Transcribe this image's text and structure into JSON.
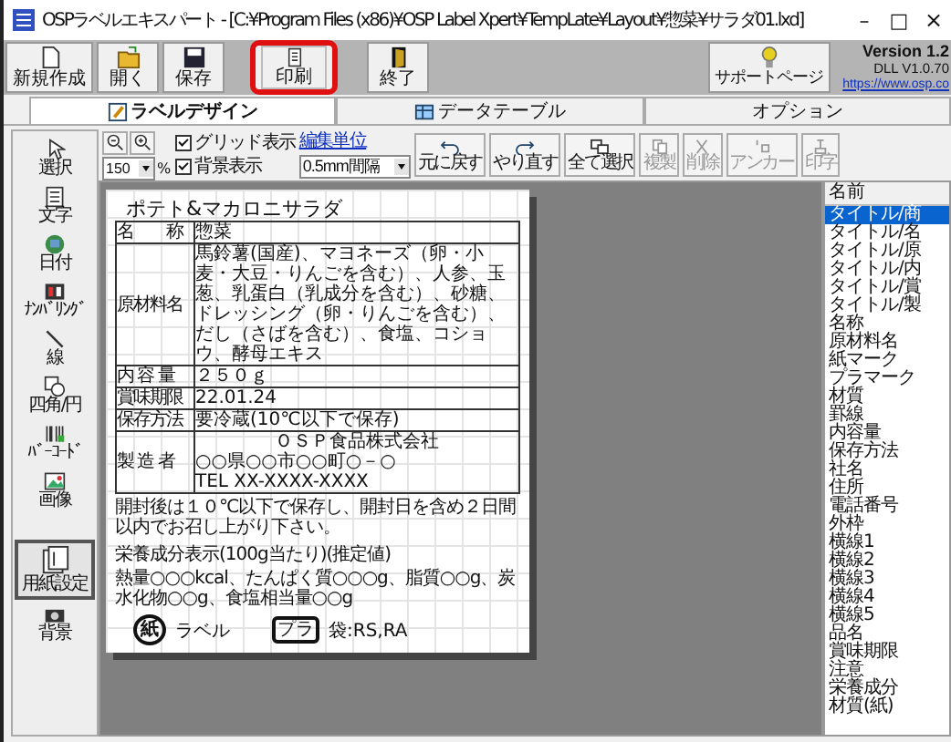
{
  "window": {
    "title": "OSPラベルエキスパート - [C:¥Program Files (x86)¥OSP Label Xpert¥TempLate¥Layout¥惣菜¥サラダ01.lxd]",
    "controls": [
      {
        "kind": "minimize",
        "label": "–"
      },
      {
        "kind": "maximize",
        "label": "□"
      },
      {
        "kind": "close",
        "label": "×"
      }
    ]
  },
  "toolbar": {
    "buttons": [
      {
        "kind": "new",
        "label": "新規作成",
        "highlighted": false
      },
      {
        "kind": "open",
        "label": "開く",
        "highlighted": false
      },
      {
        "kind": "save",
        "label": "保存",
        "highlighted": false
      },
      {
        "kind": "print",
        "label": "印刷",
        "highlighted": true
      },
      {
        "kind": "exit",
        "label": "終了",
        "highlighted": false
      }
    ],
    "support_button": "サポートページ",
    "version": "Version 1.2",
    "dll": "DLL V1.0.70",
    "url": "https://www.osp.co"
  },
  "tabs": [
    {
      "kind": "design",
      "label": "ラベルデザイン",
      "selected": true
    },
    {
      "kind": "table",
      "label": "データテーブル",
      "selected": false
    },
    {
      "kind": "option",
      "label": "オプション",
      "selected": false
    }
  ],
  "tools": [
    {
      "kind": "select",
      "label": "選択",
      "selected": false
    },
    {
      "kind": "text",
      "label": "文字",
      "selected": false
    },
    {
      "kind": "date",
      "label": "日付",
      "selected": false
    },
    {
      "kind": "numbering",
      "label": "ﾅﾝﾊﾞﾘﾝｸﾞ",
      "selected": false
    },
    {
      "kind": "line",
      "label": "線",
      "selected": false
    },
    {
      "kind": "rect",
      "label": "四角/円",
      "selected": false
    },
    {
      "kind": "barcode",
      "label": "ﾊﾞｰｺｰﾄﾞ",
      "selected": false
    },
    {
      "kind": "image",
      "label": "画像",
      "selected": false
    },
    {
      "kind": "paper",
      "label": "用紙設定",
      "selected": true
    },
    {
      "kind": "background",
      "label": "背景",
      "selected": false
    }
  ],
  "design_toolbar": {
    "zoom": "150",
    "zoom_unit": "%",
    "grid": {
      "label": "グリッド表示",
      "checked": true
    },
    "background": {
      "label": "背景表示",
      "checked": true
    },
    "unit_link": "編集単位",
    "unit": "0.5mm間隔",
    "buttons": [
      {
        "kind": "undo",
        "label": "元に戻す",
        "disabled": false
      },
      {
        "kind": "redo",
        "label": "やり直す",
        "disabled": false
      },
      {
        "kind": "select_all",
        "label": "全て選択",
        "disabled": false
      },
      {
        "kind": "copy",
        "label": "複製",
        "disabled": true
      },
      {
        "kind": "delete",
        "label": "削除",
        "disabled": true
      },
      {
        "kind": "anchor",
        "label": "アンカー",
        "disabled": true
      },
      {
        "kind": "print",
        "label": "印字",
        "disabled": true
      }
    ]
  },
  "label": {
    "title": "ポテト&マカロニサラダ",
    "rows": [
      {
        "heading": "名　　称",
        "lines": [
          "惣菜"
        ]
      },
      {
        "heading": "原材料名",
        "lines": [
          "馬鈴薯(国産)、マヨネーズ（卵・小麦・大豆・りんごを含む）、人参、玉葱、乳蛋白（乳成分を含む）、砂糖、ドレッシング（卵・りんごを含む）、だし（さばを含む）、食塩、コショウ、酵母エキス"
        ]
      },
      {
        "heading": "内 容 量",
        "lines": [
          "２５０ｇ"
        ]
      },
      {
        "heading": "賞味期限",
        "lines": [
          "22.01.24"
        ]
      },
      {
        "heading": "保存方法",
        "lines": [
          "要冷蔵(10℃以下で保存)"
        ]
      },
      {
        "heading": "製 造 者",
        "lines": [
          "ＯＳＰ食品株式会社",
          "○○県○○市○○町○－○",
          "TEL XX-XXXX-XXXX"
        ]
      }
    ],
    "notes": [
      "開封後は１０℃以下で保存し、開封日を含め２日間以内でお召し上がり下さい。",
      "栄養成分表示(100g当たり)(推定値)",
      "熱量○○○kcal、たんぱく質○○○g、脂質○○g、炭水化物○○g、食塩相当量○○g"
    ],
    "marks": [
      {
        "kind": "paper",
        "symbol": "紙",
        "text": "ラベル"
      },
      {
        "kind": "plastic",
        "symbol": "プラ",
        "text": "袋:RS,RA"
      }
    ]
  },
  "object_list": {
    "header": "名前",
    "items": [
      {
        "label": "タイトル/商",
        "selected": true
      },
      {
        "label": "タイトル/名",
        "selected": false
      },
      {
        "label": "タイトル/原",
        "selected": false
      },
      {
        "label": "タイトル/内",
        "selected": false
      },
      {
        "label": "タイトル/賞",
        "selected": false
      },
      {
        "label": "タイトル/製",
        "selected": false
      },
      {
        "label": "名称",
        "selected": false
      },
      {
        "label": "原材料名",
        "selected": false
      },
      {
        "label": "紙マーク",
        "selected": false
      },
      {
        "label": "プラマーク",
        "selected": false
      },
      {
        "label": "材質",
        "selected": false
      },
      {
        "label": "罫線",
        "selected": false
      },
      {
        "label": "内容量",
        "selected": false
      },
      {
        "label": "保存方法",
        "selected": false
      },
      {
        "label": "社名",
        "selected": false
      },
      {
        "label": "住所",
        "selected": false
      },
      {
        "label": "電話番号",
        "selected": false
      },
      {
        "label": "外枠",
        "selected": false
      },
      {
        "label": "横線1",
        "selected": false
      },
      {
        "label": "横線2",
        "selected": false
      },
      {
        "label": "横線3",
        "selected": false
      },
      {
        "label": "横線4",
        "selected": false
      },
      {
        "label": "横線5",
        "selected": false
      },
      {
        "label": "品名",
        "selected": false
      },
      {
        "label": "賞味期限",
        "selected": false
      },
      {
        "label": "注意",
        "selected": false
      },
      {
        "label": "栄養成分",
        "selected": false
      },
      {
        "label": "材質(紙)",
        "selected": false
      }
    ]
  }
}
